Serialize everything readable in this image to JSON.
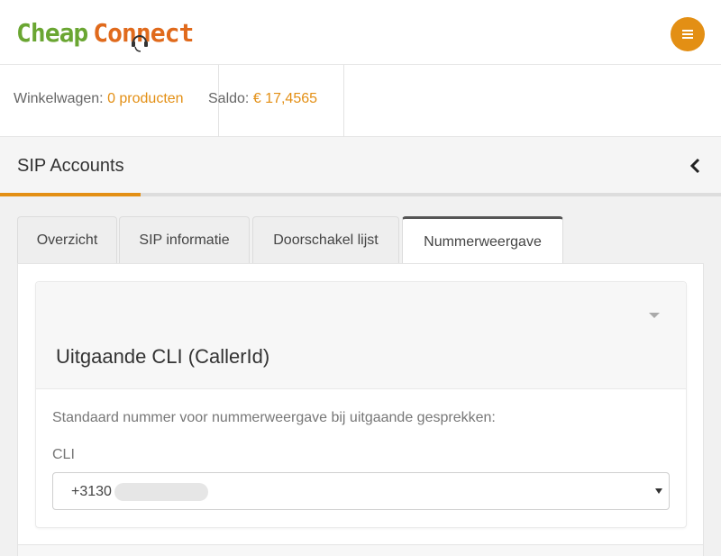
{
  "brand": {
    "part1": "Cheap",
    "part2": "Connect",
    "primary_color": "#6aa632",
    "accent_color": "#e06a1c"
  },
  "header": {
    "menu_icon": "hamburger-icon",
    "menu_color": "#e38f14"
  },
  "infobar": {
    "cart_label": "Winkelwagen:",
    "cart_value": "0 producten",
    "balance_label": "Saldo:",
    "balance_value": "€ 17,4565"
  },
  "page": {
    "title": "SIP Accounts",
    "collapse_icon": "chevron-left-icon"
  },
  "tabs": [
    {
      "label": "Overzicht",
      "active": false
    },
    {
      "label": "SIP informatie",
      "active": false
    },
    {
      "label": "Doorschakel lijst",
      "active": false
    },
    {
      "label": "Nummerweergave",
      "active": true
    }
  ],
  "section": {
    "title": "Uitgaande CLI (CallerId)",
    "description": "Standaard nummer voor nummerweergave bij uitgaande gesprekken:",
    "field_label": "CLI",
    "field_value": "+3130"
  }
}
